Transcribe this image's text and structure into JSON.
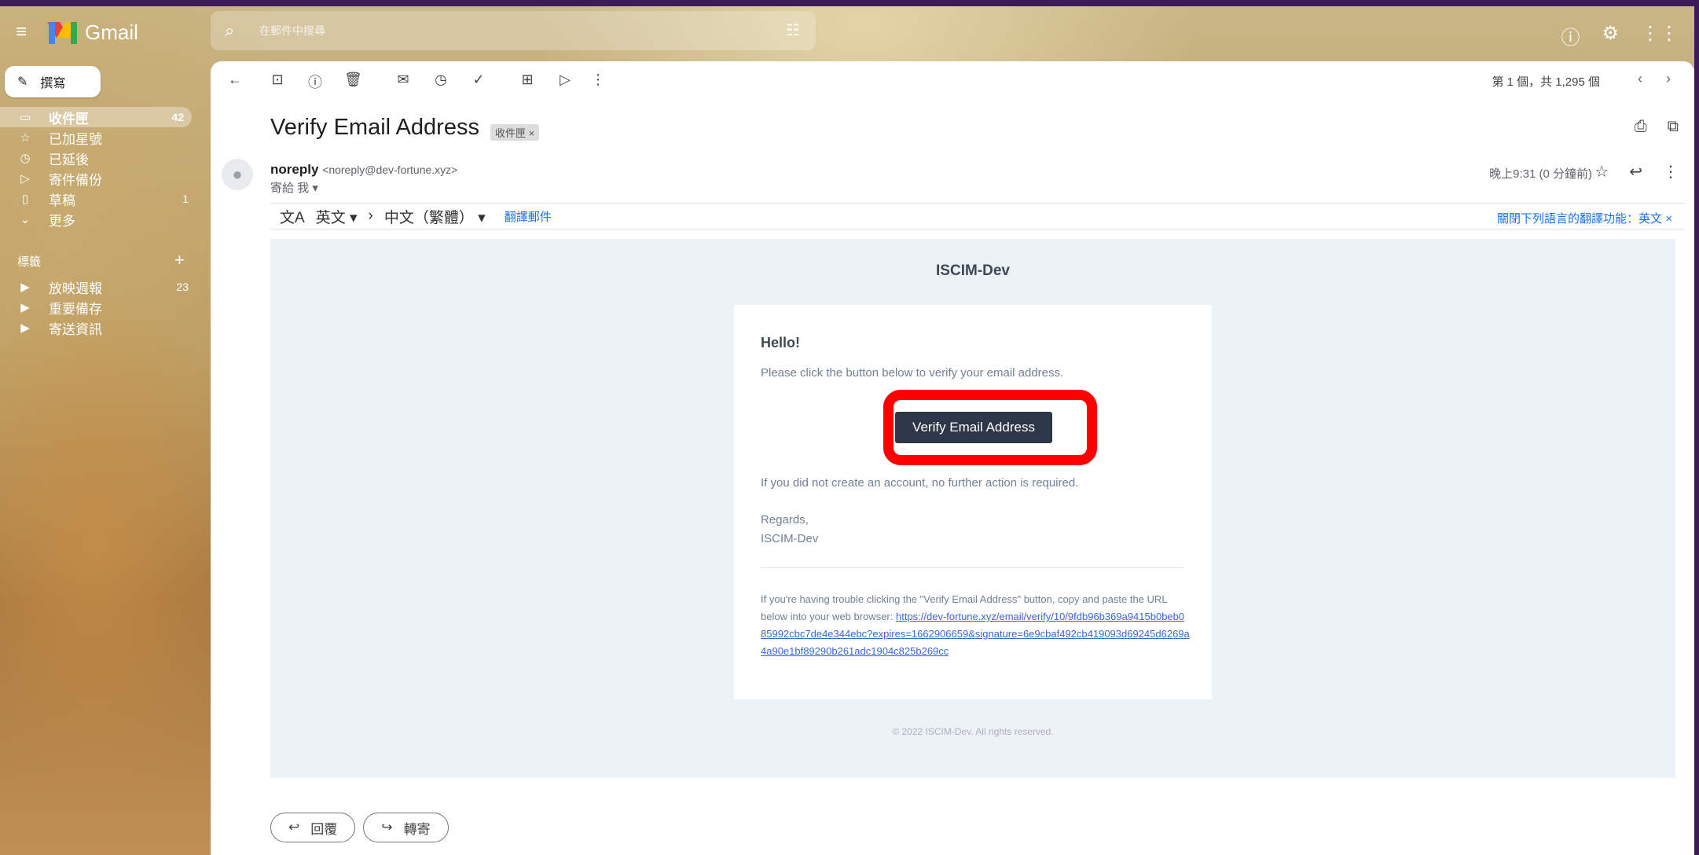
{
  "app": {
    "name": "Gmail"
  },
  "search": {
    "placeholder": "在郵件中搜尋"
  },
  "compose": {
    "label": "撰寫"
  },
  "nav": {
    "items": [
      {
        "label": "收件匣",
        "icon": "inbox-icon",
        "count": "42"
      },
      {
        "label": "已加星號",
        "icon": "star-icon",
        "count": ""
      },
      {
        "label": "已延後",
        "icon": "clock-icon",
        "count": ""
      },
      {
        "label": "寄件備份",
        "icon": "send-icon",
        "count": ""
      },
      {
        "label": "草稿",
        "icon": "draft-icon",
        "count": "1"
      },
      {
        "label": "更多",
        "icon": "chevron-down-icon",
        "count": ""
      }
    ],
    "labels_title": "標籤",
    "labels": [
      {
        "label": "放映週報",
        "count": "23"
      },
      {
        "label": "重要備存",
        "count": ""
      },
      {
        "label": "寄送資訊",
        "count": ""
      }
    ]
  },
  "toolbar": {
    "pager": "第 1 個，共 1,295 個"
  },
  "message": {
    "subject": "Verify Email Address",
    "tag": "收件匣",
    "sender_name": "noreply",
    "sender_addr": "<noreply@dev-fortune.xyz>",
    "to": "寄給 我",
    "time": "晚上9:31 (0 分鐘前)"
  },
  "translate": {
    "from": "英文",
    "to": "中文（繁體）",
    "link": "翻譯郵件",
    "off": "關閉下列語言的翻譯功能：英文"
  },
  "email": {
    "brand": "ISCIM-Dev",
    "hello": "Hello!",
    "p1": "Please click the button below to verify your email address.",
    "button": "Verify Email Address",
    "p2": "If you did not create an account, no further action is required.",
    "regards": "Regards,",
    "signature": "ISCIM-Dev",
    "trouble": "If you're having trouble clicking the \"Verify Email Address\" button, copy and paste the URL below into your web browser:",
    "url": "https://dev-fortune.xyz/email/verify/10/9fdb96b369a9415b0beb085992cbc7de4e344ebc?expires=1662906659&signature=6e9cbaf492cb419093d69245d6269a4a90e1bf89290b261adc1904c825b269cc",
    "footer": "© 2022 ISCIM-Dev. All rights reserved."
  },
  "actions": {
    "reply": "回覆",
    "forward": "轉寄"
  },
  "colors": {
    "accent": "#1a73e8",
    "button": "#2d3748",
    "highlight": "#ff0000"
  }
}
